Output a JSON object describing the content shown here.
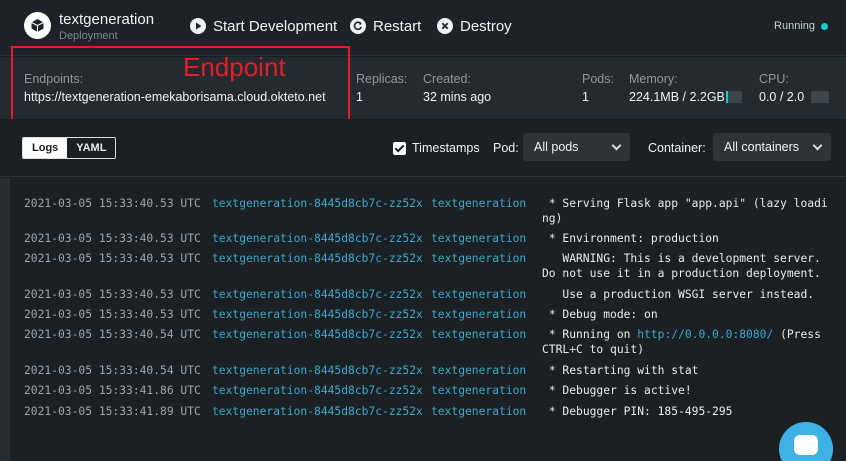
{
  "app": {
    "name": "textgeneration",
    "type": "Deployment"
  },
  "actions": {
    "start": "Start Development",
    "restart": "Restart",
    "destroy": "Destroy"
  },
  "status": {
    "label": "Running",
    "color": "#1dc9c9"
  },
  "stats": {
    "endpoints_label": "Endpoints:",
    "endpoints_value": "https://textgeneration-emekaborisama.cloud.okteto.net",
    "replicas_label": "Replicas:",
    "replicas_value": "1",
    "created_label": "Created:",
    "created_value": "32 mins ago",
    "pods_label": "Pods:",
    "pods_value": "1",
    "memory_label": "Memory:",
    "memory_value": "224.1MB / 2.2GB",
    "memory_fraction": 0.1,
    "cpu_label": "CPU:",
    "cpu_value": "0.0 / 2.0",
    "cpu_fraction": 0.0
  },
  "annotation": {
    "text": "Endpoint",
    "color": "#e21f25"
  },
  "toolbar": {
    "tabs": [
      "Logs",
      "YAML"
    ],
    "timestamps_label": "Timestamps",
    "pod_label": "Pod:",
    "pod_value": "All pods",
    "container_label": "Container:",
    "container_value": "All containers"
  },
  "logs": [
    {
      "ts": "2021-03-05 15:33:40.53 UTC",
      "pod": "textgeneration-8445d8cb7c-zz52x",
      "container": "textgeneration",
      "msg": " * Serving Flask app \"app.api\" (lazy loading)"
    },
    {
      "ts": "2021-03-05 15:33:40.53 UTC",
      "pod": "textgeneration-8445d8cb7c-zz52x",
      "container": "textgeneration",
      "msg": " * Environment: production"
    },
    {
      "ts": "2021-03-05 15:33:40.53 UTC",
      "pod": "textgeneration-8445d8cb7c-zz52x",
      "container": "textgeneration",
      "msg": "   WARNING: This is a development server. Do not use it in a production deployment."
    },
    {
      "ts": "2021-03-05 15:33:40.53 UTC",
      "pod": "textgeneration-8445d8cb7c-zz52x",
      "container": "textgeneration",
      "msg": "   Use a production WSGI server instead."
    },
    {
      "ts": "2021-03-05 15:33:40.53 UTC",
      "pod": "textgeneration-8445d8cb7c-zz52x",
      "container": "textgeneration",
      "msg": " * Debug mode: on"
    },
    {
      "ts": "2021-03-05 15:33:40.54 UTC",
      "pod": "textgeneration-8445d8cb7c-zz52x",
      "container": "textgeneration",
      "msg_pre": " * Running on ",
      "msg_link": "http://0.0.0.0:8080/",
      "msg_post": " (Press CTRL+C to quit)"
    },
    {
      "ts": "2021-03-05 15:33:40.54 UTC",
      "pod": "textgeneration-8445d8cb7c-zz52x",
      "container": "textgeneration",
      "msg": " * Restarting with stat"
    },
    {
      "ts": "2021-03-05 15:33:41.86 UTC",
      "pod": "textgeneration-8445d8cb7c-zz52x",
      "container": "textgeneration",
      "msg": " * Debugger is active!"
    },
    {
      "ts": "2021-03-05 15:33:41.89 UTC",
      "pod": "textgeneration-8445d8cb7c-zz52x",
      "container": "textgeneration",
      "msg": " * Debugger PIN: 185-495-295"
    }
  ]
}
